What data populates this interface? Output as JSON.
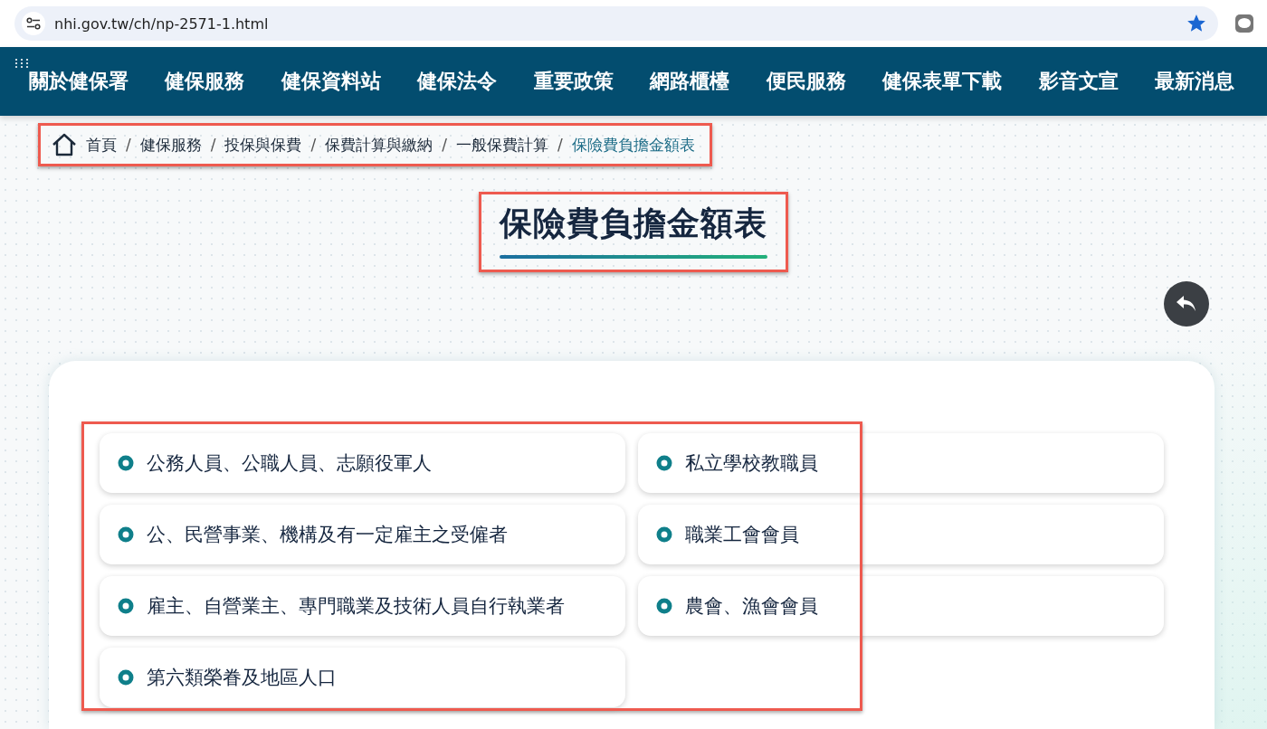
{
  "browser": {
    "url": "nhi.gov.tw/ch/np-2571-1.html",
    "bookmarked": true
  },
  "nav": {
    "items": [
      "關於健保署",
      "健保服務",
      "健保資料站",
      "健保法令",
      "重要政策",
      "網路櫃檯",
      "便民服務",
      "健保表單下載",
      "影音文宣",
      "最新消息"
    ]
  },
  "breadcrumb": {
    "highlighted": true,
    "separator": "/",
    "items": [
      {
        "label": "首頁",
        "current": false
      },
      {
        "label": "健保服務",
        "current": false
      },
      {
        "label": "投保與保費",
        "current": false
      },
      {
        "label": "保費計算與繳納",
        "current": false
      },
      {
        "label": "一般保費計算",
        "current": false
      },
      {
        "label": "保險費負擔金額表",
        "current": true
      }
    ]
  },
  "page_title": {
    "text": "保險費負擔金額表",
    "highlighted": true
  },
  "categories": {
    "highlighted": true,
    "items": [
      {
        "label": "公務人員、公職人員、志願役軍人"
      },
      {
        "label": "私立學校教職員"
      },
      {
        "label": "公、民營事業、機構及有一定雇主之受僱者"
      },
      {
        "label": "職業工會會員"
      },
      {
        "label": "雇主、自營業主、專門職業及技術人員自行執業者"
      },
      {
        "label": "農會、漁會會員"
      },
      {
        "label": "第六類榮眷及地區人口"
      }
    ]
  }
}
